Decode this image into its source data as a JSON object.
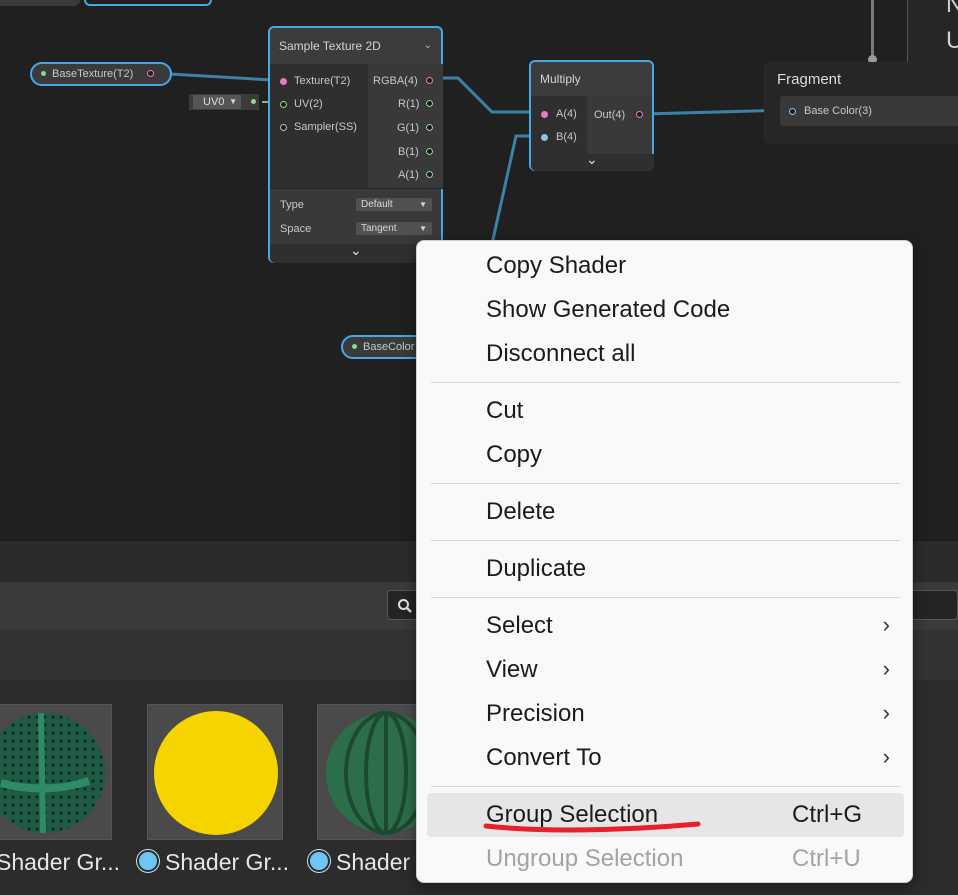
{
  "graph": {
    "property_nodes": [
      {
        "label": "BaseTexture(T2)"
      },
      {
        "label": "BaseColor"
      }
    ],
    "uv_dropdown": "UV0",
    "sample_texture": {
      "title": "Sample Texture 2D",
      "inputs": [
        "Texture(T2)",
        "UV(2)",
        "Sampler(SS)"
      ],
      "outputs": [
        "RGBA(4)",
        "R(1)",
        "G(1)",
        "B(1)",
        "A(1)"
      ],
      "type_label": "Type",
      "type_value": "Default",
      "space_label": "Space",
      "space_value": "Tangent"
    },
    "multiply": {
      "title": "Multiply",
      "inputs": [
        "A(4)",
        "B(4)"
      ],
      "output": "Out(4)"
    },
    "fragment": {
      "title": "Fragment",
      "port": "Base Color(3)"
    },
    "corner_letters": [
      "N",
      "U"
    ]
  },
  "assets": [
    {
      "label": "Shader Gr..."
    },
    {
      "label": "Shader Gr..."
    },
    {
      "label": "Shader"
    }
  ],
  "context_menu": {
    "items": [
      {
        "label": "Copy Shader"
      },
      {
        "label": "Show Generated Code"
      },
      {
        "label": "Disconnect all"
      },
      {
        "label": "Cut"
      },
      {
        "label": "Copy"
      },
      {
        "label": "Delete"
      },
      {
        "label": "Duplicate"
      },
      {
        "label": "Select"
      },
      {
        "label": "View"
      },
      {
        "label": "Precision"
      },
      {
        "label": "Convert To"
      },
      {
        "label": "Group Selection",
        "shortcut": "Ctrl+G"
      },
      {
        "label": "Ungroup Selection",
        "shortcut": "Ctrl+U"
      }
    ],
    "submenu_arrow": "›"
  },
  "colors": {
    "selection_blue": "#44a9e6",
    "edge_blue": "#3b82a6",
    "annotation_red": "#e8202a",
    "preview_yellow": "#f5d400",
    "preview_green": "#2d6e4a"
  }
}
